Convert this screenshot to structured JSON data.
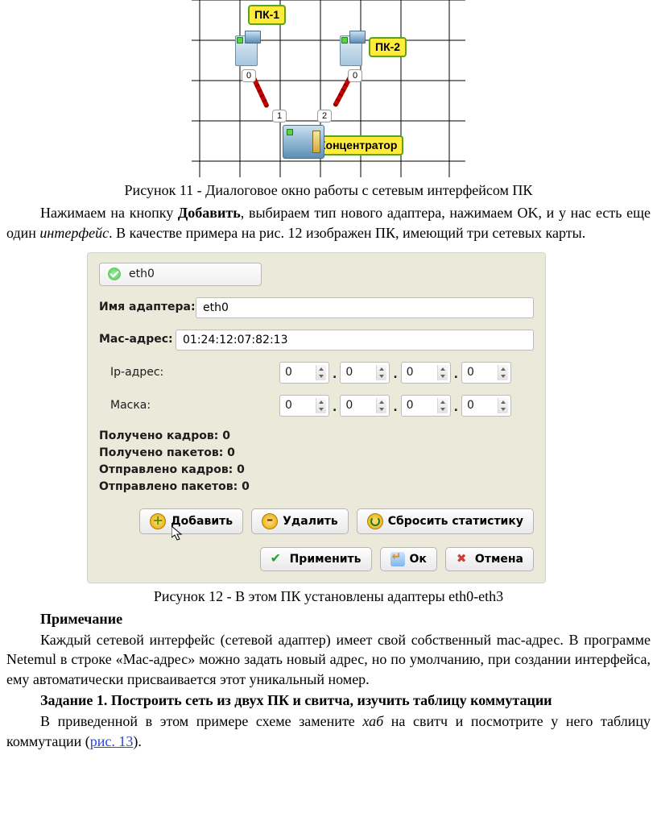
{
  "fig11": {
    "pc1_label": "ПК-1",
    "pc2_label": "ПК-2",
    "hub_label": "Концентратор",
    "ports_pc": [
      "0",
      "0"
    ],
    "ports_hub": [
      "1",
      "2"
    ]
  },
  "caption11": "Рисунок 11 - Диалоговое окно работы с сетевым интерфейсом ПК",
  "para1a": "Нажимаем на кнопку ",
  "para1_bold": "Добавить",
  "para1b": ", выбираем тип нового адаптера, нажимаем OK, и у нас есть еще один ",
  "para1_italic": "интерфейс",
  "para1c": ". В качестве примера на рис. 12 изображен ПК, имеющий три сетевых карты.",
  "dialog": {
    "tab_label": "eth0",
    "adapter_name_label": "Имя адаптера:",
    "adapter_name_value": "eth0",
    "mac_label": "Mac-адрес:",
    "mac_value": "01:24:12:07:82:13",
    "ip_label": "Ip-адрес:",
    "mask_label": "Маска:",
    "ip": [
      "0",
      "0",
      "0",
      "0"
    ],
    "mask": [
      "0",
      "0",
      "0",
      "0"
    ],
    "stats": {
      "frames_in": "Получено кадров: 0",
      "packets_in": "Получено пакетов: 0",
      "frames_out": "Отправлено кадров: 0",
      "packets_out": "Отправлено пакетов: 0"
    },
    "buttons": {
      "add": "Добавить",
      "delete": "Удалить",
      "reset": "Сбросить статистику",
      "apply": "Применить",
      "ok": "Ок",
      "cancel": "Отмена"
    }
  },
  "caption12": "Рисунок 12 - В этом ПК установлены адаптеры eth0-eth3",
  "note_heading": "Примечание",
  "note_body": "Каждый сетевой интерфейс (сетевой адаптер) имеет свой собственный mac-адрес. В программе Netemul в строке «Mac-адрес» можно задать новый адрес, но по умолчанию, при создании интерфейса, ему автоматически присваивается этот уникальный номер.",
  "task_heading": "Задание 1. Построить сеть из двух ПК и свитча, изучить таблицу коммутации",
  "task_a": "В приведенной в этом примере схеме замените ",
  "task_italic": "хаб",
  "task_b": " на свитч и посмотрите у него таблицу коммутации (",
  "task_link": "рис. 13",
  "task_c": ")."
}
